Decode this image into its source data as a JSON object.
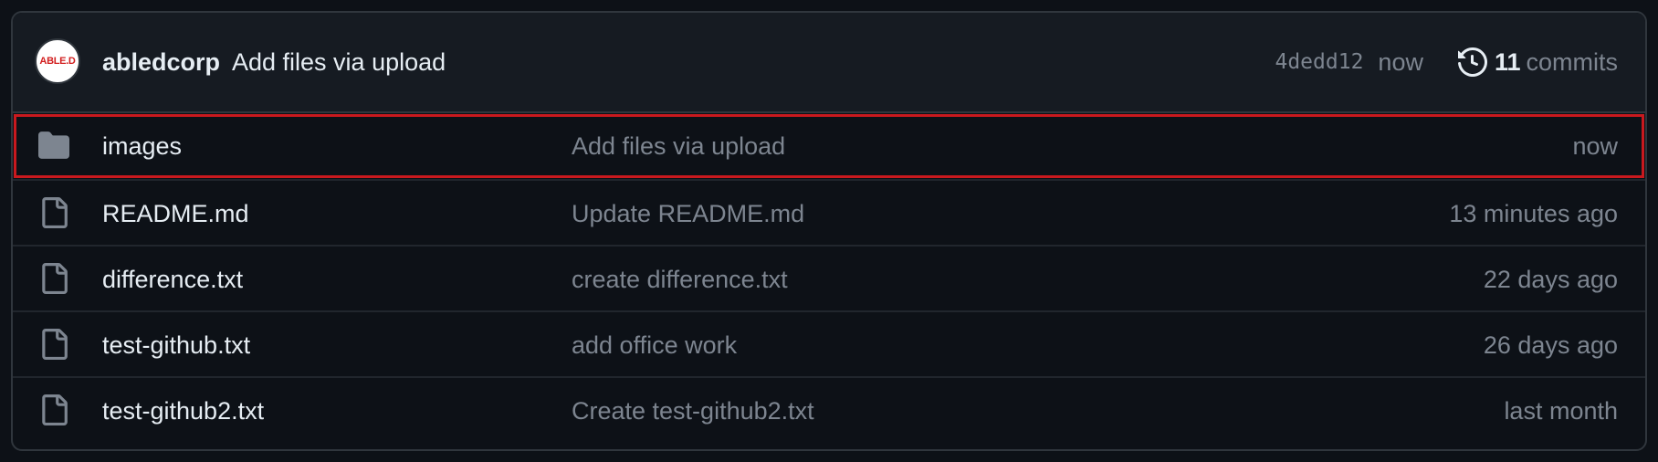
{
  "latest_commit": {
    "avatar_text": "ABLE.D",
    "author": "abledcorp",
    "message": "Add files via upload",
    "sha": "4dedd12",
    "time": "now",
    "commit_count": "11",
    "commit_word": "commits",
    "history_icon": "history-icon"
  },
  "files": [
    {
      "name": "images",
      "type": "folder",
      "icon": "folder-icon",
      "message": "Add files via upload",
      "time": "now",
      "highlighted": true
    },
    {
      "name": "README.md",
      "type": "file",
      "icon": "file-icon",
      "message": "Update README.md",
      "time": "13 minutes ago",
      "highlighted": false
    },
    {
      "name": "difference.txt",
      "type": "file",
      "icon": "file-icon",
      "message": "create difference.txt",
      "time": "22 days ago",
      "highlighted": false
    },
    {
      "name": "test-github.txt",
      "type": "file",
      "icon": "file-icon",
      "message": "add office work",
      "time": "26 days ago",
      "highlighted": false
    },
    {
      "name": "test-github2.txt",
      "type": "file",
      "icon": "file-icon",
      "message": "Create test-github2.txt",
      "time": "last month",
      "highlighted": false
    }
  ],
  "colors": {
    "background": "#0d1117",
    "header_bg": "#161b22",
    "border": "#30363d",
    "text_primary": "#e6edf3",
    "text_muted": "#7d8590",
    "folder_icon": "#7d8590",
    "highlight_outline": "#c9191e"
  }
}
